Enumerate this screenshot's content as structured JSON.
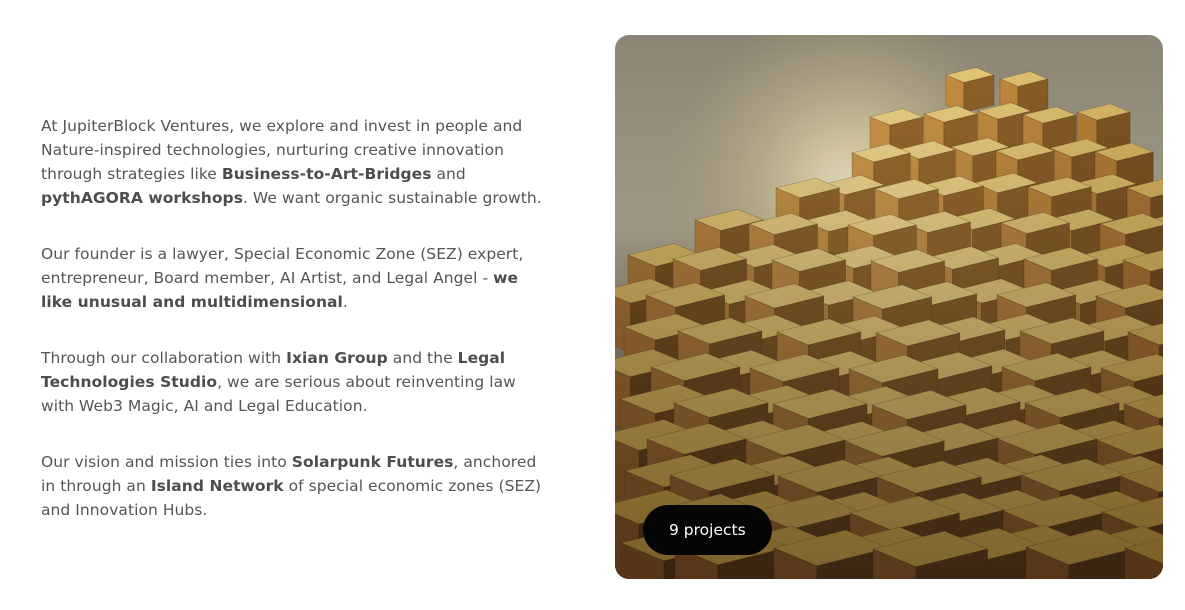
{
  "about": {
    "p1": {
      "t1": "At JupiterBlock Ventures, we explore and invest in people and Nature-inspired technologies, nurturing creative innovation through strategies like ",
      "b1": "Business-to-Art-Bridges",
      "t2": " and ",
      "b2": "pythAGORA workshops",
      "t3": ". We want organic sustainable growth."
    },
    "p2": {
      "t1": "Our founder is a lawyer, Special Economic Zone (SEZ) expert, entrepreneur, Board member, AI Artist, and Legal Angel - ",
      "b1": "we like unusual and multidimensional",
      "t2": "."
    },
    "p3": {
      "t1": "Through our collaboration with ",
      "b1": "Ixian Group",
      "t2": " and the ",
      "b2": "Legal Technologies Studio",
      "t3": ", we are serious about reinventing law with Web3 Magic, AI and Legal Education."
    },
    "p4": {
      "t1": "Our vision and mission ties into ",
      "b1": "Solarpunk Futures",
      "t2": ", anchored in through an ",
      "b2": "Island Network",
      "t3": " of special economic zones (SEZ) and Innovation Hubs."
    }
  },
  "hero": {
    "badge_label": "9 projects",
    "image_subject": "golden-cubes-sculpture"
  }
}
